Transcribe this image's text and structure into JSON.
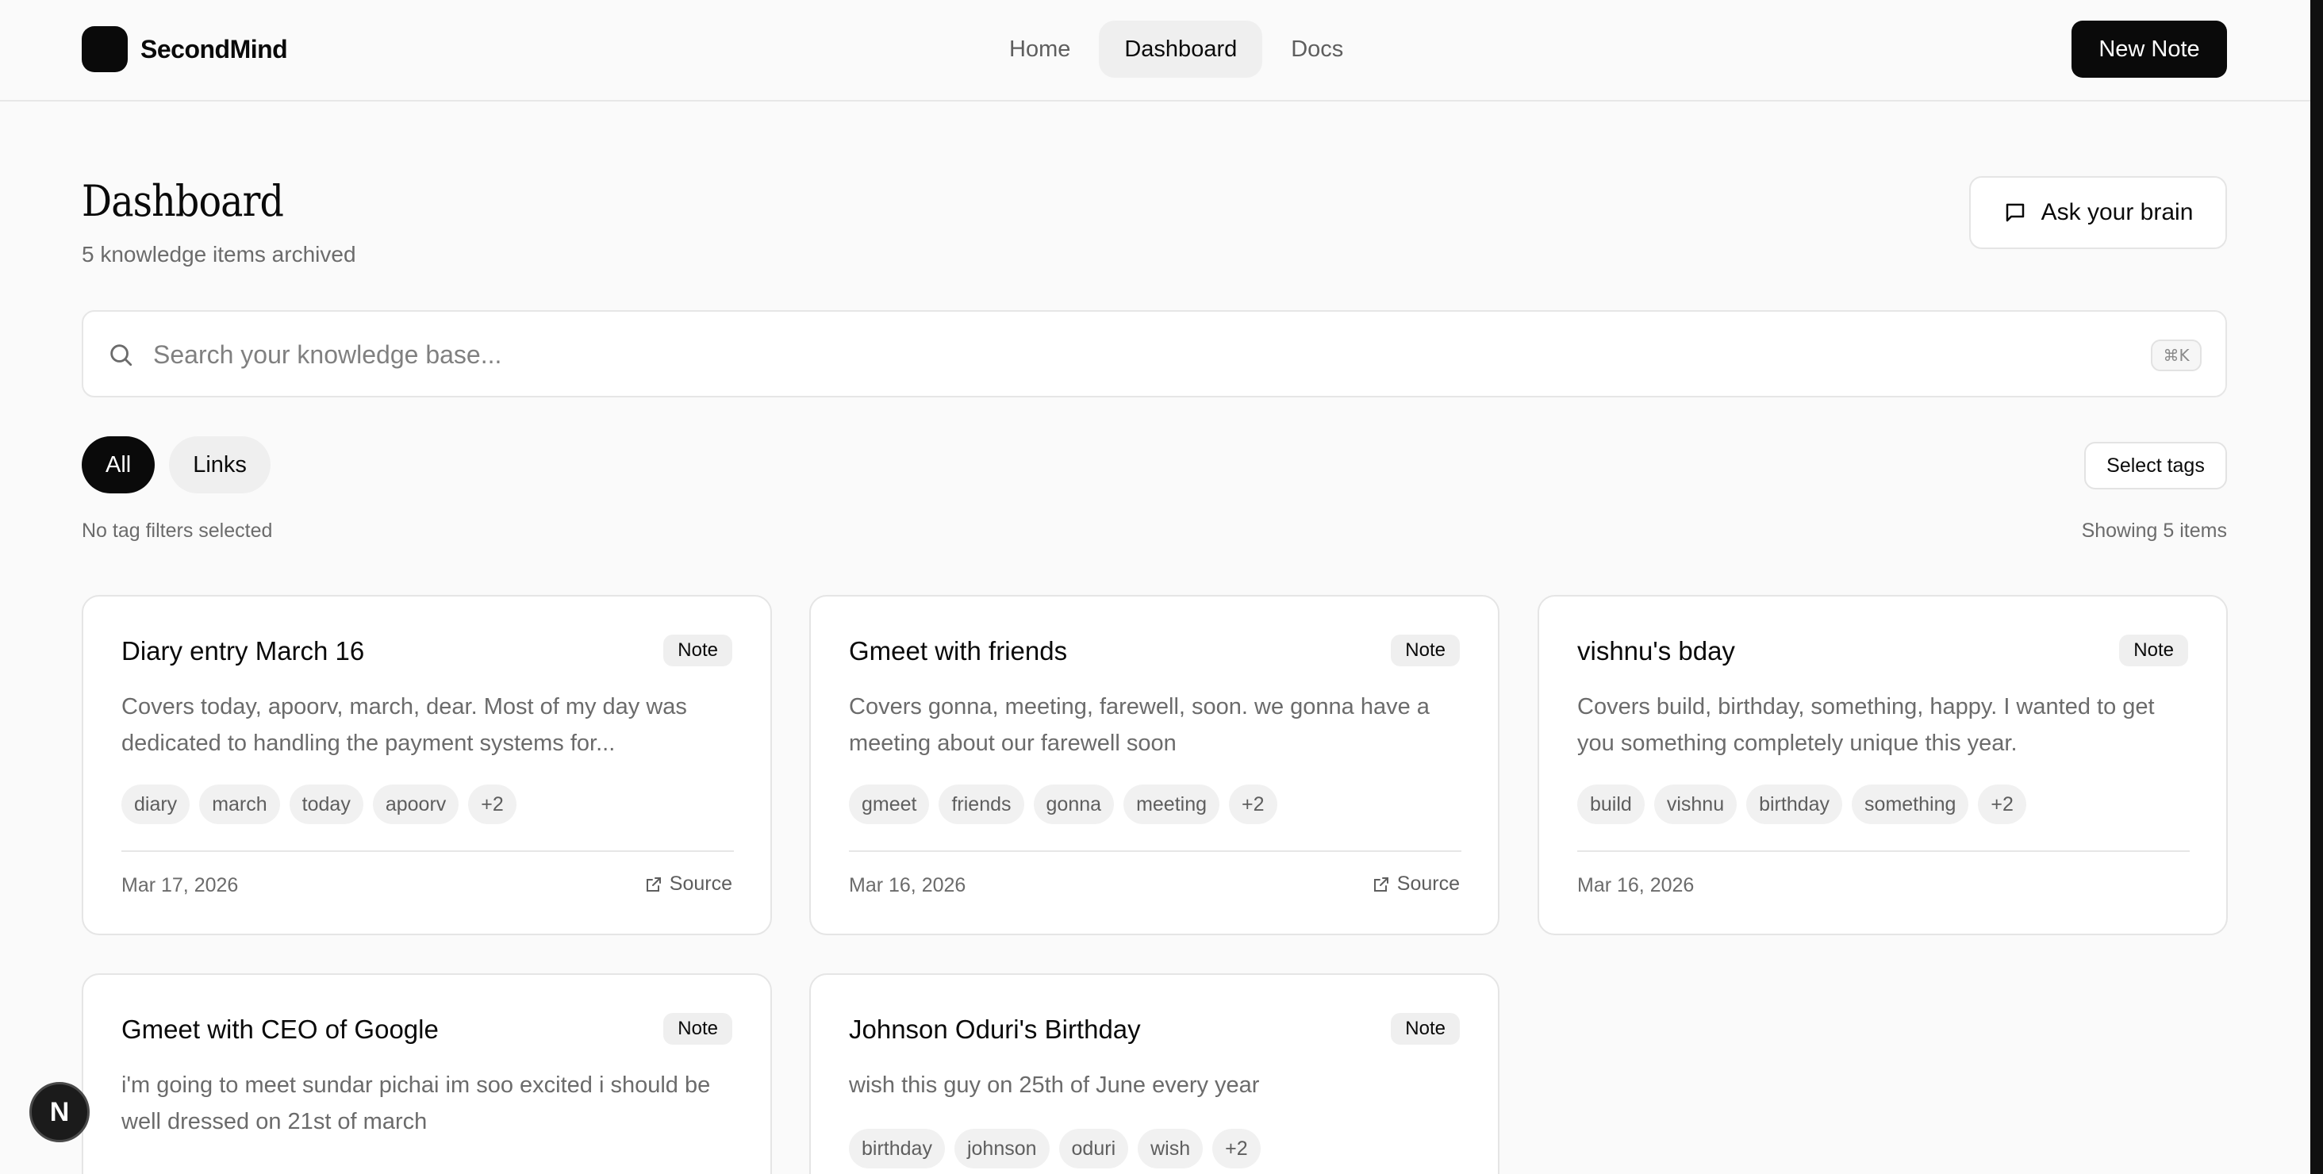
{
  "app": {
    "name": "SecondMind"
  },
  "nav": {
    "items": [
      {
        "label": "Home"
      },
      {
        "label": "Dashboard"
      },
      {
        "label": "Docs"
      }
    ]
  },
  "header": {
    "new_note_label": "New Note"
  },
  "page": {
    "title": "Dashboard",
    "subtitle": "5 knowledge items archived",
    "ask_label": "Ask your brain"
  },
  "search": {
    "placeholder": "Search your knowledge base...",
    "shortcut": "⌘K",
    "value": ""
  },
  "filters": {
    "types": [
      {
        "label": "All"
      },
      {
        "label": "Links"
      }
    ],
    "select_tags_label": "Select tags",
    "tag_status": "No tag filters selected",
    "count_text": "Showing 5 items"
  },
  "cards": [
    {
      "title": "Diary entry March 16",
      "badge": "Note",
      "description": "Covers today, apoorv, march, dear. Most of my day was dedicated to handling the payment systems for...",
      "tags": [
        "diary",
        "march",
        "today",
        "apoorv",
        "+2"
      ],
      "date": "Mar 17, 2026",
      "source_label": "Source"
    },
    {
      "title": "Gmeet with friends",
      "badge": "Note",
      "description": "Covers gonna, meeting, farewell, soon. we gonna have a meeting about our farewell soon",
      "tags": [
        "gmeet",
        "friends",
        "gonna",
        "meeting",
        "+2"
      ],
      "date": "Mar 16, 2026",
      "source_label": "Source"
    },
    {
      "title": "vishnu's bday",
      "badge": "Note",
      "description": "Covers build, birthday, something, happy. I wanted to get you something completely unique this year.",
      "tags": [
        "build",
        "vishnu",
        "birthday",
        "something",
        "+2"
      ],
      "date": "Mar 16, 2026"
    },
    {
      "title": "Gmeet with CEO of Google",
      "badge": "Note",
      "description": "i'm going to meet sundar pichai im soo excited i should be well dressed on 21st of march"
    },
    {
      "title": "Johnson Oduri's Birthday",
      "badge": "Note",
      "description": "wish this guy on 25th of June every year",
      "tags": [
        "birthday",
        "johnson",
        "oduri",
        "wish",
        "+2"
      ]
    }
  ],
  "dev_badge": {
    "label": "N"
  }
}
